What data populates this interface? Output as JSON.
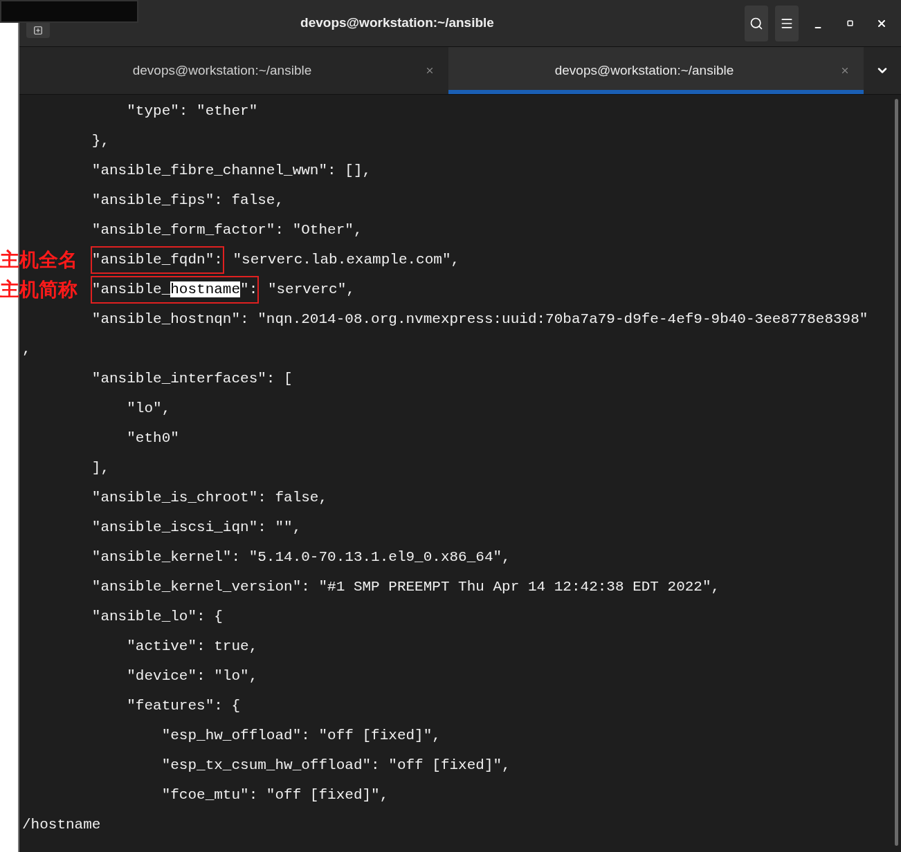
{
  "window": {
    "title": "devops@workstation:~/ansible"
  },
  "tabs": [
    {
      "label": "devops@workstation:~/ansible",
      "selected": false
    },
    {
      "label": "devops@workstation:~/ansible",
      "selected": true
    }
  ],
  "terminal": {
    "lines": [
      {
        "segments": [
          {
            "text": "            \"type\": \"ether\""
          }
        ]
      },
      {
        "segments": [
          {
            "text": "        },"
          }
        ]
      },
      {
        "segments": [
          {
            "text": "        \"ansible_fibre_channel_wwn\": [],"
          }
        ]
      },
      {
        "segments": [
          {
            "text": "        \"ansible_fips\": false,"
          }
        ]
      },
      {
        "segments": [
          {
            "text": "        \"ansible_form_factor\": \"Other\","
          }
        ]
      },
      {
        "annotation": "主机全名",
        "segments": [
          {
            "text": "\"ansible_fqdn\":",
            "boxed": true
          },
          {
            "text": " \"serverc.lab.example.com\","
          }
        ]
      },
      {
        "annotation": "主机简称",
        "segments": [
          {
            "text": "\"ansible_",
            "boxed": true
          },
          {
            "text": "hostname",
            "boxed": true,
            "match": true
          },
          {
            "text": "\":",
            "boxed": true
          },
          {
            "text": " \"serverc\","
          }
        ]
      },
      {
        "segments": [
          {
            "text": "        \"ansible_hostnqn\": \"nqn.2014-08.org.nvmexpress:uuid:70ba7a79-d9fe-4ef9-9b40-3ee8778e8398\""
          }
        ]
      },
      {
        "segments": [
          {
            "text": ","
          }
        ]
      },
      {
        "segments": [
          {
            "text": "        \"ansible_interfaces\": ["
          }
        ]
      },
      {
        "segments": [
          {
            "text": "            \"lo\","
          }
        ]
      },
      {
        "segments": [
          {
            "text": "            \"eth0\""
          }
        ]
      },
      {
        "segments": [
          {
            "text": "        ],"
          }
        ]
      },
      {
        "segments": [
          {
            "text": "        \"ansible_is_chroot\": false,"
          }
        ]
      },
      {
        "segments": [
          {
            "text": "        \"ansible_iscsi_iqn\": \"\","
          }
        ]
      },
      {
        "segments": [
          {
            "text": "        \"ansible_kernel\": \"5.14.0-70.13.1.el9_0.x86_64\","
          }
        ]
      },
      {
        "segments": [
          {
            "text": "        \"ansible_kernel_version\": \"#1 SMP PREEMPT Thu Apr 14 12:42:38 EDT 2022\","
          }
        ]
      },
      {
        "segments": [
          {
            "text": "        \"ansible_lo\": {"
          }
        ]
      },
      {
        "segments": [
          {
            "text": "            \"active\": true,"
          }
        ]
      },
      {
        "segments": [
          {
            "text": "            \"device\": \"lo\","
          }
        ]
      },
      {
        "segments": [
          {
            "text": "            \"features\": {"
          }
        ]
      },
      {
        "segments": [
          {
            "text": "                \"esp_hw_offload\": \"off [fixed]\","
          }
        ]
      },
      {
        "segments": [
          {
            "text": "                \"esp_tx_csum_hw_offload\": \"off [fixed]\","
          }
        ]
      },
      {
        "segments": [
          {
            "text": "                \"fcoe_mtu\": \"off [fixed]\","
          }
        ]
      },
      {
        "segments": [
          {
            "text": "/hostname"
          }
        ]
      }
    ]
  }
}
